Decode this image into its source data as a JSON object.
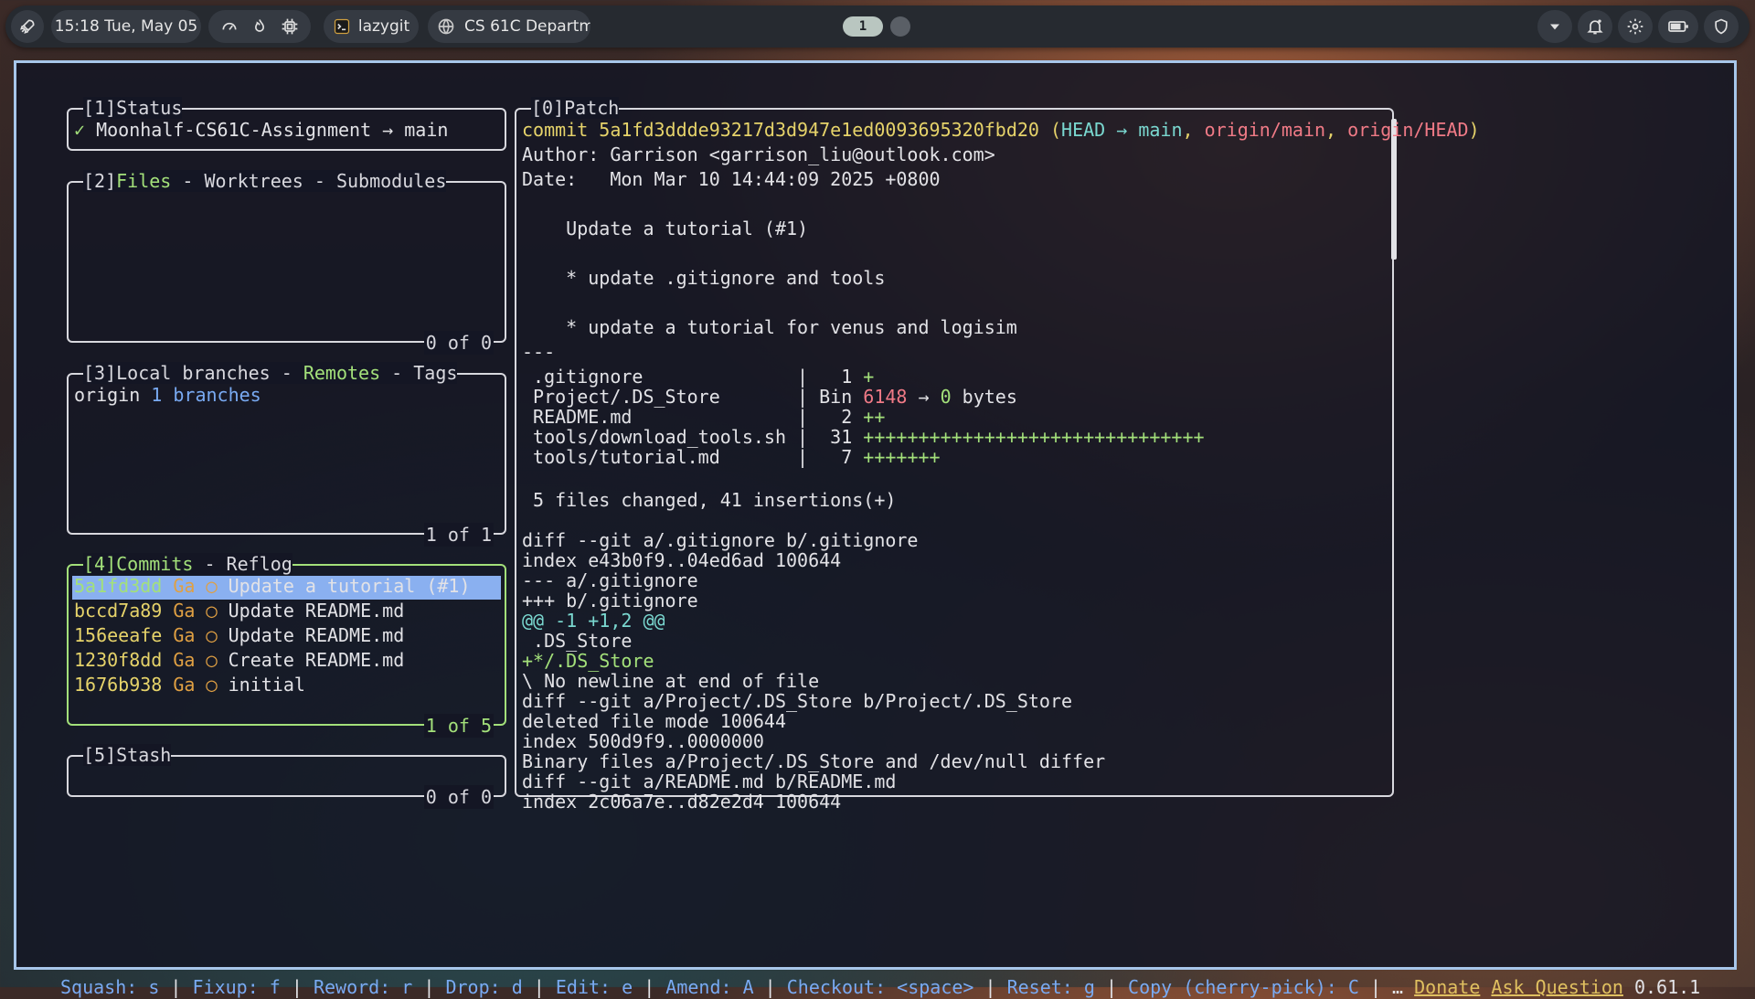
{
  "topbar": {
    "datetime": "15:18 Tue, May 05",
    "app_name": "lazygit",
    "browser_tab": "CS 61C Departm",
    "workspace_active": "1",
    "icons": [
      "rocket-icon",
      "gauge-icon",
      "fire-icon",
      "cpu-icon",
      "terminal-icon",
      "globe-icon",
      "chevron-down-icon",
      "bell-icon",
      "gear-icon",
      "battery-icon",
      "shield-icon"
    ]
  },
  "panels": {
    "status": {
      "title_prefix": "[1]",
      "title": "Status",
      "check": "✓",
      "repo": "Moonhalf-CS61C-Assignment",
      "arrow": "→",
      "branch": "main"
    },
    "files": {
      "title_prefix": "[2]",
      "tab1": "Files",
      "sep1": " - ",
      "tab2": "Worktrees",
      "sep2": " - ",
      "tab3": "Submodules",
      "footer": "0 of 0"
    },
    "branches": {
      "title_prefix": "[3]",
      "tab1": "Local branches",
      "sep1": " - ",
      "tab2": "Remotes",
      "sep2": " - ",
      "tab3": "Tags",
      "remote_name": "origin",
      "remote_count": "1 branches",
      "footer": "1 of 1"
    },
    "commits": {
      "title_prefix": "[4]",
      "tab1": "Commits",
      "sep1": " - ",
      "tab2": "Reflog",
      "footer": "1 of 5",
      "rows": [
        {
          "hash": "5a1fd3dd",
          "author": "Ga",
          "mark": "◯",
          "msg": "Update a tutorial (#1)"
        },
        {
          "hash": "bccd7a89",
          "author": "Ga",
          "mark": "◯",
          "msg": "Update README.md"
        },
        {
          "hash": "156eeafe",
          "author": "Ga",
          "mark": "◯",
          "msg": "Update README.md"
        },
        {
          "hash": "1230f8dd",
          "author": "Ga",
          "mark": "◯",
          "msg": "Create README.md"
        },
        {
          "hash": "1676b938",
          "author": "Ga",
          "mark": "◯",
          "msg": "initial"
        }
      ]
    },
    "stash": {
      "title_prefix": "[5]",
      "title": "Stash",
      "footer": "0 of 0"
    },
    "patch": {
      "title_prefix": "[0]",
      "title": "Patch",
      "commit_label": "commit",
      "commit_hash": "5a1fd3ddde93217d3d947e1ed0093695320fbd20",
      "refs_open": "(",
      "ref_head": "HEAD → main",
      "ref_sep1": ", ",
      "ref_origin_main": "origin/main",
      "ref_sep2": ", ",
      "ref_origin_head": "origin/HEAD",
      "refs_close": ")",
      "author": "Author: Garrison <garrison_liu@outlook.com>",
      "date": "Date:   Mon Mar 10 14:44:09 2025 +0800",
      "msg_title": "    Update a tutorial (#1)",
      "msg_b1": "    * update .gitignore and tools",
      "msg_b2": "    * update a tutorial for venus and logisim",
      "sep": "---",
      "stat": [
        {
          "file": " .gitignore              |   1 ",
          "plus": "+",
          "extra": ""
        },
        {
          "file": " Project/.DS_Store       | Bin ",
          "plus": "",
          "extra": "bin"
        },
        {
          "file": " README.md               |   2 ",
          "plus": "++",
          "extra": ""
        },
        {
          "file": " tools/download_tools.sh |  31 ",
          "plus": "+++++++++++++++++++++++++++++++",
          "extra": ""
        },
        {
          "file": " tools/tutorial.md       |   7 ",
          "plus": "+++++++",
          "extra": ""
        }
      ],
      "bin_from": "6148",
      "bin_arrow": " → ",
      "bin_to": "0",
      "bin_unit": " bytes",
      "summary": " 5 files changed, 41 insertions(+)",
      "diff_lines": [
        {
          "text": "diff --git a/.gitignore b/.gitignore",
          "kind": "plain"
        },
        {
          "text": "index e43b0f9..04ed6ad 100644",
          "kind": "plain"
        },
        {
          "text": "--- a/.gitignore",
          "kind": "plain"
        },
        {
          "text": "+++ b/.gitignore",
          "kind": "plain"
        },
        {
          "text": "@@ -1 +1,2 @@",
          "kind": "hunk"
        },
        {
          "text": " .DS_Store",
          "kind": "plain"
        },
        {
          "text": "+*/.DS_Store",
          "kind": "add"
        },
        {
          "text": "\\ No newline at end of file",
          "kind": "plain"
        },
        {
          "text": "diff --git a/Project/.DS_Store b/Project/.DS_Store",
          "kind": "plain"
        },
        {
          "text": "deleted file mode 100644",
          "kind": "plain"
        },
        {
          "text": "index 500d9f9..0000000",
          "kind": "plain"
        },
        {
          "text": "Binary files a/Project/.DS_Store and /dev/null differ",
          "kind": "plain"
        },
        {
          "text": "diff --git a/README.md b/README.md",
          "kind": "plain"
        },
        {
          "text": "index 2c06a7e..d82e2d4 100644",
          "kind": "plain"
        }
      ]
    }
  },
  "keybindings": {
    "items": [
      "Squash: s",
      "Fixup: f",
      "Reword: r",
      "Drop: d",
      "Edit: e",
      "Amend: A",
      "Checkout: <space>",
      "Reset: g",
      "Copy (cherry-pick): C"
    ],
    "separator": " | ",
    "ellipsis": " | …",
    "donate": "Donate",
    "ask": "Ask Question",
    "version": "0.61.1"
  }
}
